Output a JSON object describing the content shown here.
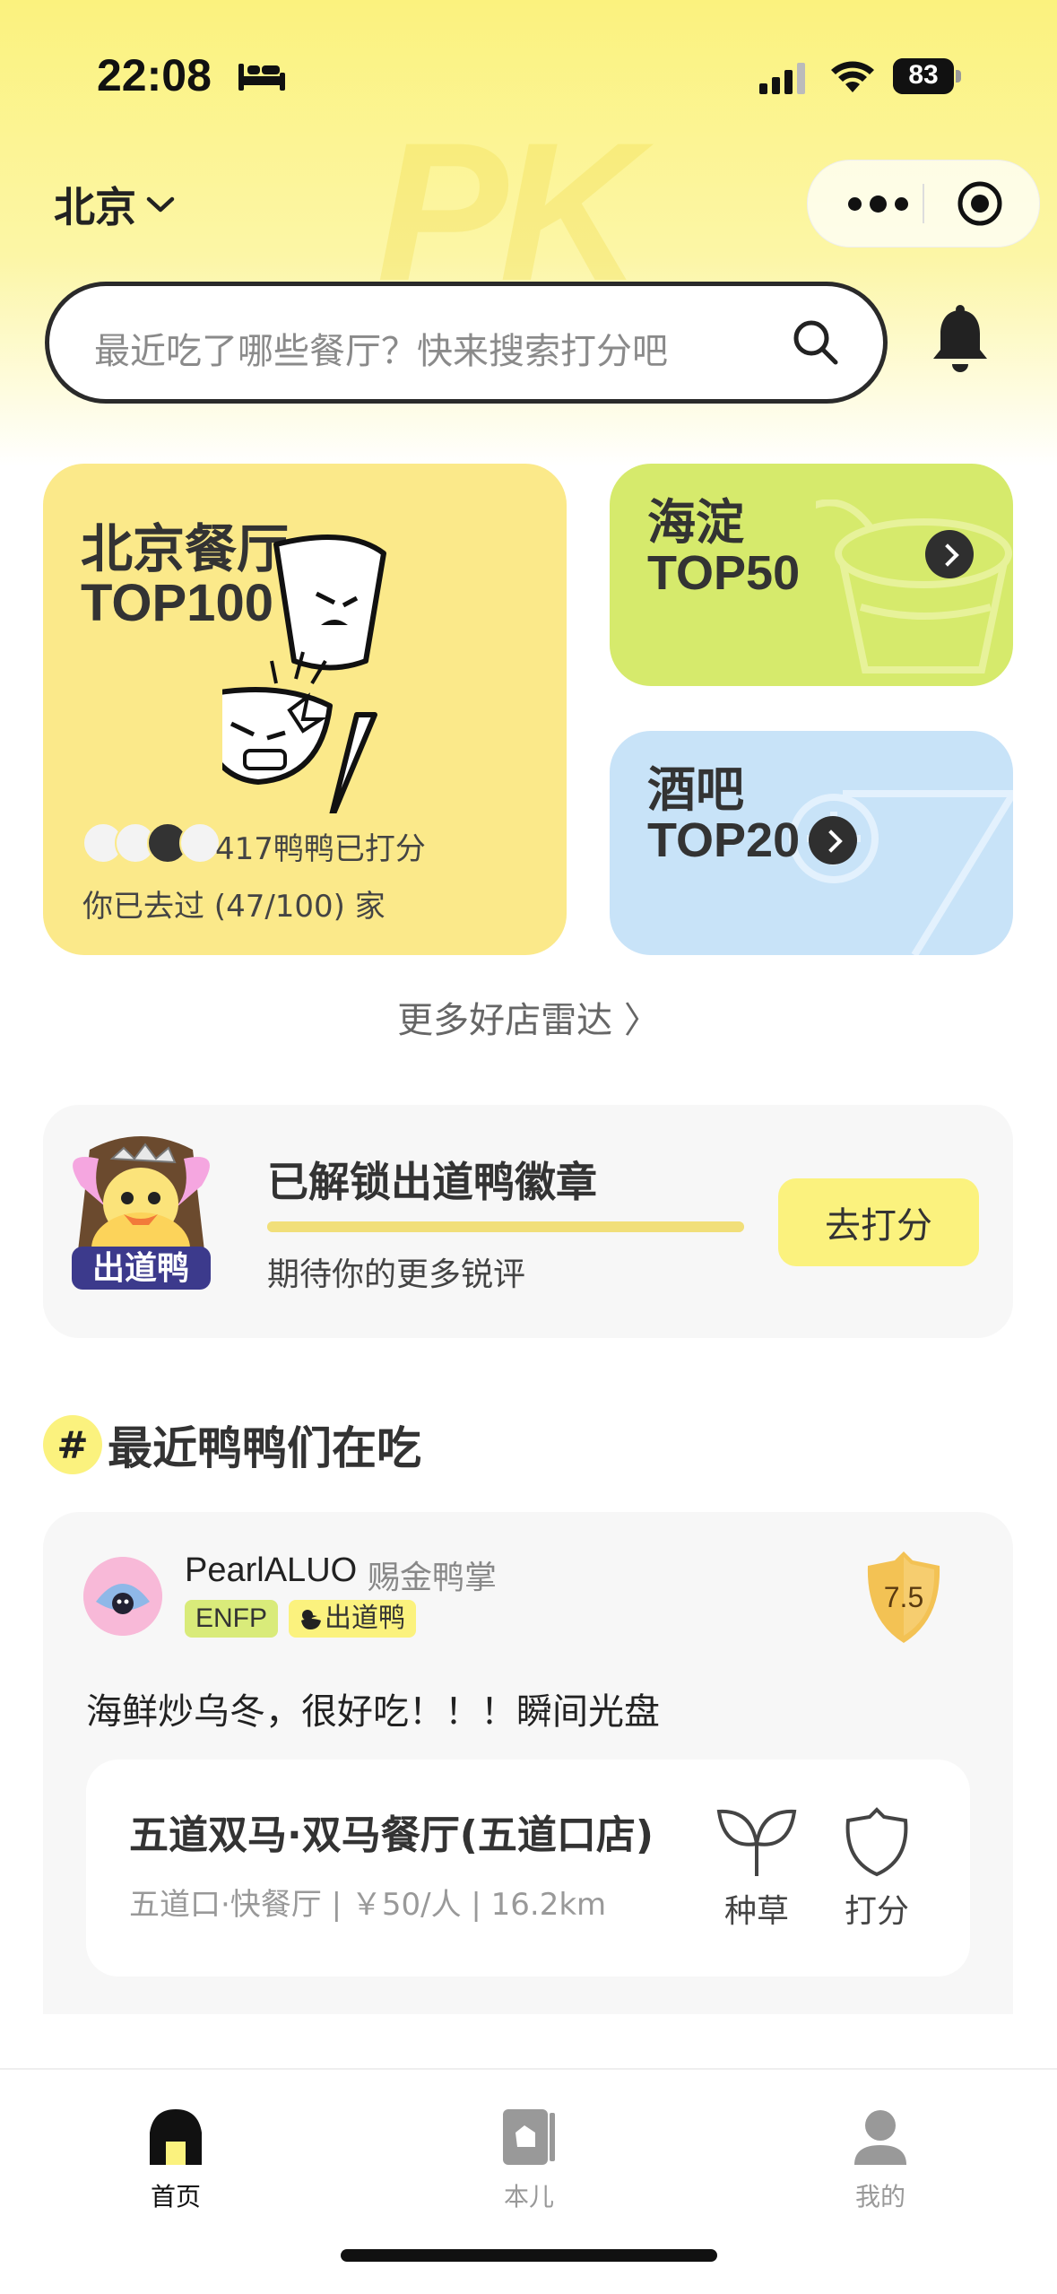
{
  "status_bar": {
    "time": "22:08",
    "battery": "83",
    "battery_level": 0.83
  },
  "header": {
    "city": "北京"
  },
  "watermark": "PK",
  "search": {
    "placeholder": "最近吃了哪些餐厅？快来搜索打分吧"
  },
  "cards": {
    "main": {
      "title_line1": "北京餐厅",
      "title_line2": "TOP100",
      "count_text": "417鸭鸭已打分",
      "visited_text": "你已去过 (47/100) 家"
    },
    "haidian": {
      "line1": "海淀",
      "line2": "TOP50"
    },
    "bar": {
      "line1": "酒吧",
      "line2": "TOP20"
    }
  },
  "more_radar": "更多好店雷达 〉",
  "badge": {
    "title": "已解锁出道鸭徽章",
    "subtitle": "期待你的更多锐评",
    "button": "去打分",
    "badge_text": "出道鸭",
    "progress": 1.0
  },
  "section": {
    "hash": "#",
    "title": "最近鸭鸭们在吃"
  },
  "feed": {
    "user_name": "PearlALUO",
    "user_title": "赐金鸭掌",
    "tag_mbti": "ENFP",
    "tag_badge": "出道鸭",
    "score": "7.5",
    "review": "海鲜炒乌冬，很好吃！！！瞬间光盘",
    "restaurant": {
      "name": "五道双马·双马餐厅(五道口店)",
      "meta": "五道口·快餐厅 | ￥50/人 | 16.2km",
      "action_grass": "种草",
      "action_score": "打分"
    }
  },
  "tabbar": {
    "home": "首页",
    "book": "本儿",
    "me": "我的"
  },
  "colors": {
    "brand_yellow": "#fbf27e",
    "card_yellow": "#fbe98a",
    "card_green": "#d6ea6c",
    "card_blue": "#c8e3f8"
  }
}
